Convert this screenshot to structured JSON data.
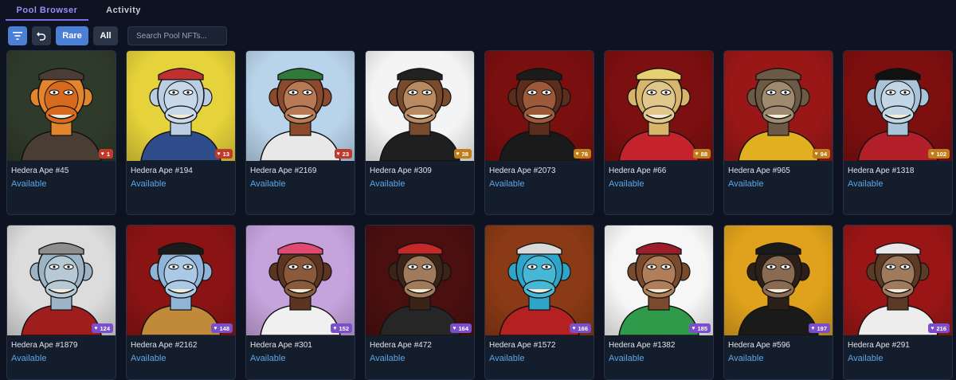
{
  "tabs": {
    "pool_browser": "Pool Browser",
    "activity": "Activity"
  },
  "toolbar": {
    "rare_label": "Rare",
    "all_label": "All",
    "search_placeholder": "Search Pool NFTs..."
  },
  "cards": [
    {
      "name": "Hedera Ape #45",
      "status": "Available",
      "rank": "1",
      "badge_color": "#c0392b",
      "bg": "#2f3b2a",
      "face": "#d86a1f",
      "fur": "#e3852d",
      "hat": "#4a3d33",
      "shirt": "#4a3d33"
    },
    {
      "name": "Hedera Ape #194",
      "status": "Available",
      "rank": "13",
      "badge_color": "#c0392b",
      "bg": "#e6d23a",
      "face": "#c7d8e8",
      "fur": "#b9cde3",
      "hat": "#c03030",
      "shirt": "#2f4d8a"
    },
    {
      "name": "Hedera Ape #2169",
      "status": "Available",
      "rank": "23",
      "badge_color": "#c0392b",
      "bg": "#b9d4ea",
      "face": "#b87a55",
      "fur": "#8b4a2b",
      "hat": "#2f7a3a",
      "shirt": "#e8e8e8"
    },
    {
      "name": "Hedera Ape #309",
      "status": "Available",
      "rank": "38",
      "badge_color": "#c07d1a",
      "bg": "#f4f4f4",
      "face": "#b78a62",
      "fur": "#7a4a2c",
      "hat": "#222222",
      "shirt": "#1f1f1f"
    },
    {
      "name": "Hedera Ape #2073",
      "status": "Available",
      "rank": "76",
      "badge_color": "#c07d1a",
      "bg": "#7a0f0f",
      "face": "#9d5a3a",
      "fur": "#5a2d1d",
      "hat": "#1c1c1c",
      "shirt": "#1a1a1a"
    },
    {
      "name": "Hedera Ape #66",
      "status": "Available",
      "rank": "88",
      "badge_color": "#c07d1a",
      "bg": "#7c0f0f",
      "face": "#e2c78c",
      "fur": "#d8b56b",
      "hat": "#e8d070",
      "shirt": "#c4232d"
    },
    {
      "name": "Hedera Ape #965",
      "status": "Available",
      "rank": "94",
      "badge_color": "#c07d1a",
      "bg": "#9a1717",
      "face": "#9f8a6e",
      "fur": "#6d5a44",
      "hat": "#6d5a44",
      "shirt": "#e0b020"
    },
    {
      "name": "Hedera Ape #1318",
      "status": "Available",
      "rank": "102",
      "badge_color": "#c07d1a",
      "bg": "#7e0f0f",
      "face": "#c2d6e6",
      "fur": "#a9c3d8",
      "hat": "#111111",
      "shirt": "#b31f28"
    },
    {
      "name": "Hedera Ape #1879",
      "status": "Available",
      "rank": "124",
      "badge_color": "#7b4fc9",
      "bg": "#dcdcdc",
      "face": "#b8c9d6",
      "fur": "#9db4c6",
      "hat": "#8d8d8d",
      "shirt": "#a01d1d"
    },
    {
      "name": "Hedera Ape #2162",
      "status": "Available",
      "rank": "148",
      "badge_color": "#7b4fc9",
      "bg": "#8a1414",
      "face": "#a9c9e6",
      "fur": "#8fb4d8",
      "hat": "#1a1a1a",
      "shirt": "#c08a3a"
    },
    {
      "name": "Hedera Ape #301",
      "status": "Available",
      "rank": "152",
      "badge_color": "#7b4fc9",
      "bg": "#c7a3de",
      "face": "#8a5a3b",
      "fur": "#5c3522",
      "hat": "#e04a70",
      "shirt": "#f0f0f0"
    },
    {
      "name": "Hedera Ape #472",
      "status": "Available",
      "rank": "164",
      "badge_color": "#7b4fc9",
      "bg": "#4a0f0f",
      "face": "#a07a5a",
      "fur": "#3a2418",
      "hat": "#c42828",
      "shirt": "#262626"
    },
    {
      "name": "Hedera Ape #1572",
      "status": "Available",
      "rank": "166",
      "badge_color": "#7b4fc9",
      "bg": "#8a3a14",
      "face": "#47b7d6",
      "fur": "#2ea5c8",
      "hat": "#d9d9d9",
      "shirt": "#b52020"
    },
    {
      "name": "Hedera Ape #1382",
      "status": "Available",
      "rank": "185",
      "badge_color": "#7b4fc9",
      "bg": "#f6f6f6",
      "face": "#b07e58",
      "fur": "#7a4a2c",
      "hat": "#9c1e2a",
      "shirt": "#2f9a4a"
    },
    {
      "name": "Hedera Ape #596",
      "status": "Available",
      "rank": "197",
      "badge_color": "#7b4fc9",
      "bg": "#e0a21c",
      "face": "#8b6a52",
      "fur": "#2b1f18",
      "hat": "#1a1a1a",
      "shirt": "#1a1a1a"
    },
    {
      "name": "Hedera Ape #291",
      "status": "Available",
      "rank": "216",
      "badge_color": "#7b4fc9",
      "bg": "#9a1616",
      "face": "#a07a5c",
      "fur": "#5c3a26",
      "hat": "#e8e8e8",
      "shirt": "#ededed"
    }
  ]
}
